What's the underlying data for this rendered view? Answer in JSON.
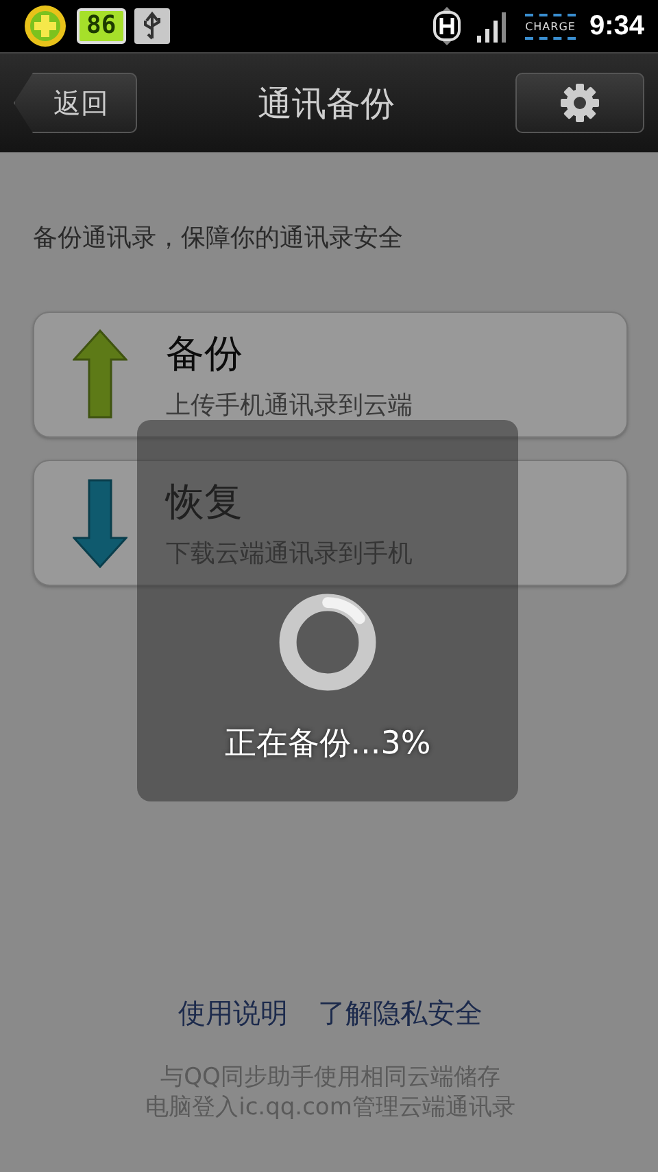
{
  "status_bar": {
    "battery": "86",
    "charge": "CHARGE",
    "time": "9:34"
  },
  "title_bar": {
    "back": "返回",
    "title": "通讯备份"
  },
  "description": "备份通讯录，保障你的通讯录安全",
  "actions": [
    {
      "kind": "upload",
      "title": "备份",
      "subtitle": "上传手机通讯录到云端"
    },
    {
      "kind": "download",
      "title": "恢复",
      "subtitle": "下载云端通讯录到手机"
    }
  ],
  "links": [
    "使用说明",
    "了解隐私安全"
  ],
  "footer": [
    "与QQ同步助手使用相同云端储存",
    "电脑登入ic.qq.com管理云端通讯录"
  ],
  "progress_dialog": {
    "message": "正在备份...3%"
  }
}
